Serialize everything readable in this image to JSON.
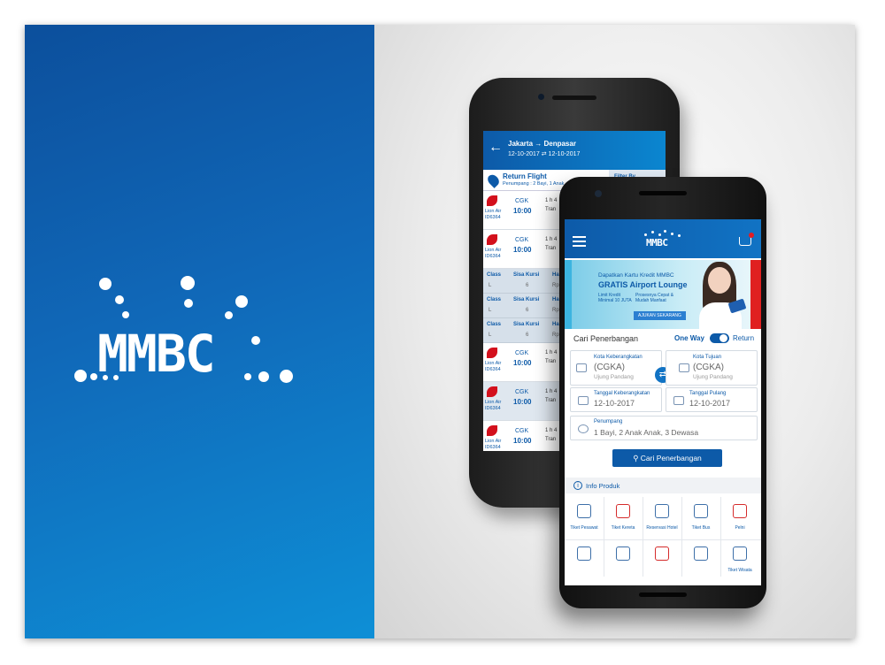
{
  "brand": {
    "logo_text": "MMBC",
    "accent_color": "#0d5aa8",
    "gradient_light": "#0e8fd6"
  },
  "back_screen": {
    "route": "Jakarta → Denpasar",
    "dates": "12-10-2017 ⇄ 12-10-2017",
    "section_title": "Return Flight",
    "passengers": "Penumpang : 2 Bayi, 1 Anak",
    "filter_label": "Filter By",
    "flights": [
      {
        "airline": "Lion Air",
        "flight_no": "ID6364",
        "code": "CGK",
        "time": "10:00",
        "duration": "1 h 4",
        "transit": "Tran"
      },
      {
        "airline": "Lion Air",
        "flight_no": "ID6364",
        "code": "CGK",
        "time": "10:00",
        "duration": "1 h 4",
        "transit": "Tran"
      },
      {
        "airline": "Lion Air",
        "flight_no": "ID6364",
        "code": "CGK",
        "time": "10:00",
        "duration": "1 h 4",
        "transit": "Tran"
      },
      {
        "airline": "Lion Air",
        "flight_no": "ID6364",
        "code": "CGK",
        "time": "10:00",
        "duration": "1 h 4",
        "transit": "Tran"
      },
      {
        "airline": "Lion Air",
        "flight_no": "ID6364",
        "code": "CGK",
        "time": "10:00",
        "duration": "1 h 4",
        "transit": "Tran"
      }
    ],
    "class_rows": [
      {
        "h1": "Class",
        "h2": "Sisa Kursi",
        "h3": "Ha",
        "v1": "L",
        "v2": "6",
        "v3": "Rp"
      },
      {
        "h1": "Class",
        "h2": "Sisa Kursi",
        "h3": "Ha",
        "v1": "L",
        "v2": "6",
        "v3": "Rp"
      },
      {
        "h1": "Class",
        "h2": "Sisa Kursi",
        "h3": "Ha",
        "v1": "L",
        "v2": "6",
        "v3": "Rp"
      }
    ]
  },
  "front_screen": {
    "logo_text": "MMBC",
    "banner": {
      "line1": "Dapatkan Kartu Kredit MMBC",
      "line2": "GRATIS Airport Lounge",
      "line3": "Limit Kredit Minimal 10 JUTA",
      "line4": "Prosesnya Cepat & Mudah Manfaat",
      "button": "AJUKAN SEKARANG"
    },
    "search_title": "Cari Penerbangan",
    "one_way": "One Way",
    "return": "Return",
    "origin": {
      "label": "Kota Keberangkatan",
      "code": "(CGKA)",
      "city": "Ujung Pandang"
    },
    "destination": {
      "label": "Kota Tujuan",
      "code": "(CGKA)",
      "city": "Ujung Pandang"
    },
    "depart": {
      "label": "Tanggal Keberangkatan",
      "value": "12-10-2017"
    },
    "arrive": {
      "label": "Tanggal Pulang",
      "value": "12-10-2017"
    },
    "passengers": {
      "label": "Penumpang",
      "value": "1 Bayi, 2 Anak Anak, 3 Dewasa"
    },
    "search_button": "Cari Penerbangan",
    "info_label": "Info Produk",
    "products": [
      {
        "label": "Tiket Pesawat",
        "icon": "plane-icon"
      },
      {
        "label": "Tiket Kereta",
        "icon": "train-icon"
      },
      {
        "label": "Reservasi Hotel",
        "icon": "hotel-icon"
      },
      {
        "label": "Tiket Bus",
        "icon": "bus-icon"
      },
      {
        "label": "Pelni",
        "icon": "ship-icon"
      },
      {
        "label": "",
        "icon": "cinema-icon"
      },
      {
        "label": "",
        "icon": "transfer-icon"
      },
      {
        "label": "",
        "icon": "insurance-icon"
      },
      {
        "label": "",
        "icon": "mobile-icon"
      },
      {
        "label": "Tiket Wisata",
        "icon": "tour-icon"
      }
    ]
  }
}
